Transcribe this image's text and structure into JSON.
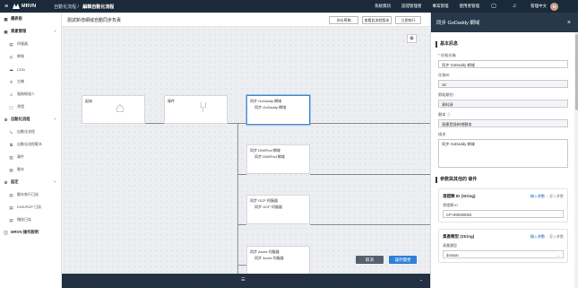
{
  "topbar": {
    "brand": "MRVN",
    "crumb_parent": "自動化流程",
    "crumb_sep": "/",
    "crumb_current": "編輯自動化流程",
    "nav": [
      "系統資訊",
      "認證管理者",
      "專案管理",
      "使用者管理"
    ],
    "user_name": "管理中文",
    "avatar_text": "M"
  },
  "sidebar": {
    "items": [
      {
        "type": "group",
        "label": "儀表板",
        "icon": "dashboard-icon",
        "glyph": "▦",
        "chevron": ""
      },
      {
        "type": "group",
        "label": "資產管理",
        "icon": "asset-icon",
        "glyph": "▣",
        "chevron": "⌃"
      },
      {
        "type": "item",
        "label": "伺服器",
        "icon": "server-icon",
        "glyph": "▤"
      },
      {
        "type": "item",
        "label": "網域",
        "icon": "globe-icon",
        "glyph": "◎"
      },
      {
        "type": "item",
        "label": "CDN",
        "icon": "cdn-icon",
        "glyph": "☁"
      },
      {
        "type": "item",
        "label": "主機",
        "icon": "host-icon",
        "glyph": "⚲"
      },
      {
        "type": "item",
        "label": "服務帳號人",
        "icon": "account-icon",
        "glyph": "☺"
      },
      {
        "type": "item",
        "label": "憑證",
        "icon": "certificate-icon",
        "glyph": "▢"
      },
      {
        "type": "group",
        "label": "自動化流程",
        "icon": "workflow-icon",
        "glyph": "⚙",
        "chevron": "⌃"
      },
      {
        "type": "item",
        "label": "自動化流程",
        "icon": "flow-icon",
        "glyph": "↳"
      },
      {
        "type": "item",
        "label": "自動化流程範本",
        "icon": "template-icon",
        "glyph": "⧉"
      },
      {
        "type": "item",
        "label": "事件",
        "icon": "event-icon",
        "glyph": "▥"
      },
      {
        "type": "item",
        "label": "腳本",
        "icon": "script-icon",
        "glyph": "▧"
      },
      {
        "type": "group",
        "label": "設定",
        "icon": "settings-icon",
        "glyph": "⚙",
        "chevron": "⌃"
      },
      {
        "type": "item",
        "label": "腳本執行日誌",
        "icon": "log-icon",
        "glyph": "▤"
      },
      {
        "type": "item",
        "label": "DNS/RDP 日誌",
        "icon": "dns-log-icon",
        "glyph": "▤"
      },
      {
        "type": "item",
        "label": "稽核日誌",
        "icon": "audit-icon",
        "glyph": "▤"
      },
      {
        "type": "group",
        "label": "MRVN 操作說明",
        "icon": "info-icon",
        "glyph": "ⓘ",
        "chevron": ""
      }
    ]
  },
  "main": {
    "title": "測試新增網域自動同步負責",
    "btn_publish": "另存草稿",
    "btn_versions": "查看此流程版本",
    "btn_run": "立即執行",
    "zoom_icon": "⊞",
    "nodes": {
      "start_label": "起始",
      "branch_label": "條件",
      "sel_line1": "同步 GoDaddy 網域",
      "sel_line2": "同步 GoDaddy 網域",
      "n2_line1": "同步 DNSPod 網域",
      "n2_line2": "同步 DNSPod 網域",
      "n3_line1": "同步 GCP 伺服器",
      "n3_line2": "同步 GCP 伺服器",
      "n4_line1": "同步 Azure 伺服器",
      "n4_line2": "同步 Azure 伺服器"
    },
    "cancel_label": "取消",
    "save_label": "儲存變更"
  },
  "panel": {
    "title": "同步 GoDaddy 網域",
    "basic_section": "基本訊息",
    "task_name_label": "任務名稱",
    "task_name_value": "同步 GoDaddy 網域",
    "id_label": "任務ID",
    "id_value": "16",
    "type_label": "節點類別",
    "type_value": "資料源",
    "script_label": "腳本",
    "script_value": "資產登錄新增腳本",
    "desc_label": "描述",
    "desc_value": "同步 GoDaddy 網域",
    "params_section": "參數與其他的 條件",
    "card1_title": "憑證類 ID (String)",
    "card1_link1": "輸入參數",
    "card1_link2": "導入參數",
    "card1_field_label": "憑證類 ID",
    "card1_field_value": "CP-000000063",
    "card2_title": "資產類型 (String)",
    "card2_link1": "輸入參數",
    "card2_link2": "導入參數",
    "card2_field_label": "資產類型",
    "card2_field_value": "domain"
  }
}
